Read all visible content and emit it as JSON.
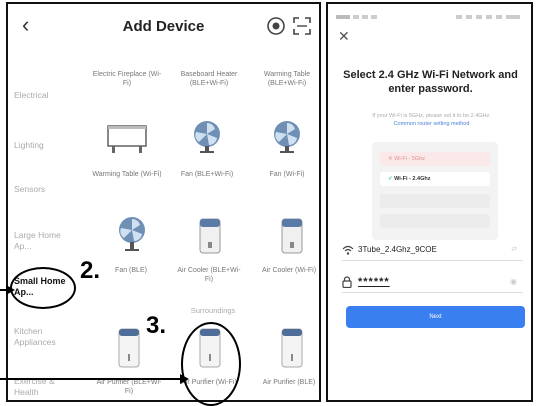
{
  "left": {
    "title": "Add Device",
    "back_icon": "chevron-left-icon",
    "categories": [
      {
        "label": "Electrical"
      },
      {
        "label": "Lighting"
      },
      {
        "label": "Sensors"
      },
      {
        "label": "Large Home Ap..."
      },
      {
        "label": "Small Home Ap..."
      },
      {
        "label": "Kitchen Appliances"
      },
      {
        "label": "Exercise & Health"
      }
    ],
    "devices": [
      {
        "label": "Electric Fireplace (Wi-Fi)"
      },
      {
        "label": "Baseboard Heater (BLE+Wi-Fi)"
      },
      {
        "label": "Warming Table (BLE+Wi-Fi)"
      },
      {
        "label": "Warming Table (Wi-Fi)"
      },
      {
        "label": "Fan (BLE+Wi-Fi)"
      },
      {
        "label": "Fan (Wi-Fi)"
      },
      {
        "label": "Fan (BLE)"
      },
      {
        "label": "Air Cooler (BLE+Wi-Fi)"
      },
      {
        "label": "Air Cooler (Wi-Fi)"
      },
      {
        "label": "Air Purifier (BLE+Wi-Fi)"
      },
      {
        "label": "Air Purifier (Wi-Fi)"
      },
      {
        "label": "Air Purifier (BLE)"
      }
    ],
    "section_label": "Surroundings",
    "annotations": {
      "step2": "2.",
      "step3": "3."
    }
  },
  "right": {
    "close_icon": "close-icon",
    "title": "Select 2.4 GHz Wi-Fi Network and enter password.",
    "subtitle": "If your Wi-Fi is 5GHz, please set it to be 2.4GHz.",
    "link": "Common router setting method",
    "illus_5g": "Wi-Fi - 5Ghz",
    "illus_24g": "Wi-Fi - 2.4Ghz",
    "network_name": "3Tube_2.4Ghz_9COE",
    "password": "******",
    "next_label": "Next"
  },
  "colors": {
    "accent": "#3a7ff0",
    "active_text": "#111111",
    "muted": "#aaaaaa"
  }
}
